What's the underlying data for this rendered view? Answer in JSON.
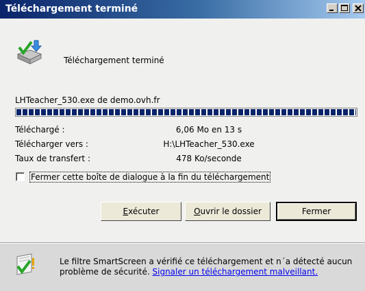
{
  "window": {
    "title": "Téléchargement terminé"
  },
  "header": {
    "text": "Téléchargement terminé"
  },
  "download": {
    "file": "LHTeacher_530.exe de demo.ovh.fr",
    "progress_percent": 100,
    "rows": [
      {
        "label": "Téléchargé :",
        "value": "6,06 Mo en 13 s"
      },
      {
        "label": "Télécharger vers :",
        "value": "H:\\LHTeacher_530.exe"
      },
      {
        "label": "Taux de transfert :",
        "value": "478 Ko/seconde"
      }
    ],
    "close_checkbox_label": "Fermer cette boîte de dialogue à la fin du téléchargement",
    "close_checkbox_checked": false
  },
  "buttons": {
    "run": {
      "mnemonic": "E",
      "rest": "xécuter"
    },
    "open_folder": {
      "mnemonic": "O",
      "rest": "uvrir le dossier"
    },
    "close": "Fermer"
  },
  "smartscreen": {
    "text": "Le filtre SmartScreen a vérifié ce téléchargement et n´a détecté aucun problème de sécurité.",
    "link": "Signaler un téléchargement malveillant."
  },
  "colors": {
    "title_bar_start": "#0a246a",
    "title_bar_end": "#a6caf0",
    "progress": "#0a246a",
    "link": "#0000ee"
  },
  "icons": {
    "download": "download-complete-icon",
    "smartscreen": "smartscreen-shield-icon",
    "minimize": "minimize-icon",
    "maximize": "maximize-icon",
    "close": "close-icon"
  }
}
